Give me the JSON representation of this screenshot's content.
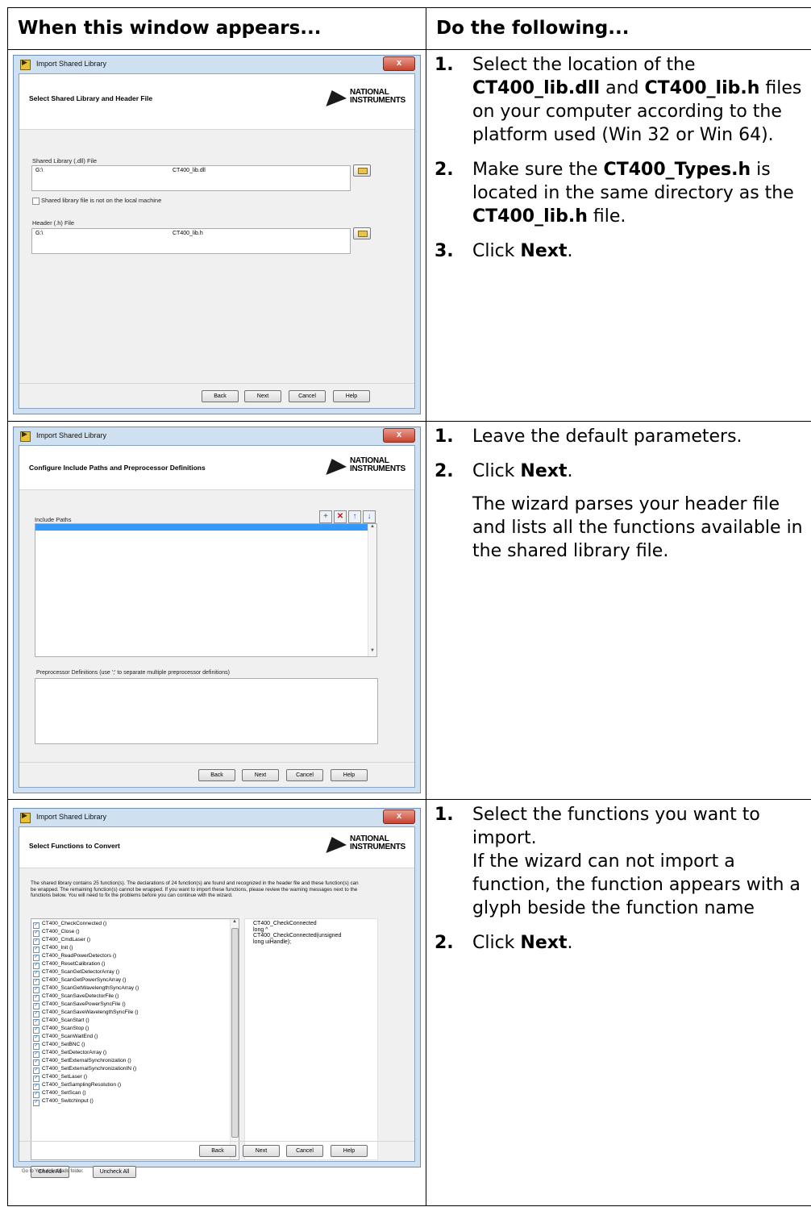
{
  "table": {
    "header_left": "When this window appears...",
    "header_right": "Do the following..."
  },
  "dialog_title": "Import Shared Library",
  "close_glyph": "x",
  "ni_logo_line1": "NATIONAL",
  "ni_logo_line2": "INSTRUMENTS",
  "buttons": {
    "back": "Back",
    "next": "Next",
    "cancel": "Cancel",
    "help": "Help"
  },
  "row1": {
    "window": {
      "heading": "Select Shared Library and Header File",
      "shared_label": "Shared Library (.dll) File",
      "shared_path": "G:\\",
      "shared_file": "CT400_lib.dll",
      "not_local_label": "Shared library file is not on the local machine",
      "header_label": "Header (.h) File",
      "header_path": "G:\\",
      "header_file": "CT400_lib.h"
    },
    "steps": [
      {
        "num": "1.",
        "t1": "Select the location of the ",
        "b1": "CT400_lib.dll",
        "t2": " and ",
        "b2": "CT400_lib.h",
        "t3": " files on your computer according to the platform used (Win 32 or Win 64)."
      },
      {
        "num": "2.",
        "t1": "Make sure the ",
        "b1": "CT400_Types.h",
        "t2": " is located in the same directory as the ",
        "b2": "CT400_lib.h",
        "t3": " file."
      },
      {
        "num": "3.",
        "t1": "Click ",
        "b1": "Next",
        "t2": "."
      }
    ]
  },
  "row2": {
    "window": {
      "heading": "Configure Include Paths and Preprocessor Definitions",
      "include_label": "Include Paths",
      "preproc_label": "Preprocessor Definitions (use ';' to separate multiple preprocessor definitions)"
    },
    "steps": [
      {
        "num": "1.",
        "t1": "Leave the default parameters."
      },
      {
        "num": "2.",
        "t1": "Click ",
        "b1": "Next",
        "t2": "."
      }
    ],
    "note": "The wizard parses your header file and lists all the functions available in the shared library file."
  },
  "row3": {
    "window": {
      "heading": "Select Functions to Convert",
      "description": "The shared library contains 25 function(s). The declarations of 24 function(s) are found and recognized in the header file and these function(s) can be wrapped. The remaining function(s) cannot be wrapped. If you want to import these functions, please review the warning messages next to the functions below. You will need to fix the problems before you can continue with the wizard.",
      "functions": [
        "CT400_CheckConnected ()",
        "CT400_Close ()",
        "CT400_CmdLaser ()",
        "CT400_Init ()",
        "CT400_ReadPowerDetectors ()",
        "CT400_ResetCalibration ()",
        "CT400_ScanGetDetectorArray ()",
        "CT400_ScanGetPowerSyncArray ()",
        "CT400_ScanGetWavelengthSyncArray ()",
        "CT400_ScanSaveDetectorFile ()",
        "CT400_ScanSavePowerSyncFile ()",
        "CT400_ScanSaveWavelengthSyncFile ()",
        "CT400_ScanStart ()",
        "CT400_ScanStop ()",
        "CT400_ScanWaitEnd ()",
        "CT400_SetBNC ()",
        "CT400_SetDetectorArray ()",
        "CT400_SetExternalSynchronization ()",
        "CT400_SetExternalSynchronizationIN ()",
        "CT400_SetLaser ()",
        "CT400_SetSamplingResolution ()",
        "CT400_SetScan ()",
        "CT400_SwitchInput ()"
      ],
      "detail_lines": [
        "CT400_CheckConnected",
        "long ^",
        "CT400_CheckConnected(unsigned",
        "long uiHandle);"
      ],
      "check_all": "Check All",
      "uncheck_all": "Uncheck All",
      "trailing_text": "Go to Your downloads folder."
    },
    "steps": [
      {
        "num": "1.",
        "t1": "Select the functions you want to import.",
        "t2": "If the wizard can not import a function, the function appears with a glyph beside the function name"
      },
      {
        "num": "2.",
        "t1": "Click ",
        "b1": "Next",
        "t2": "."
      }
    ]
  }
}
